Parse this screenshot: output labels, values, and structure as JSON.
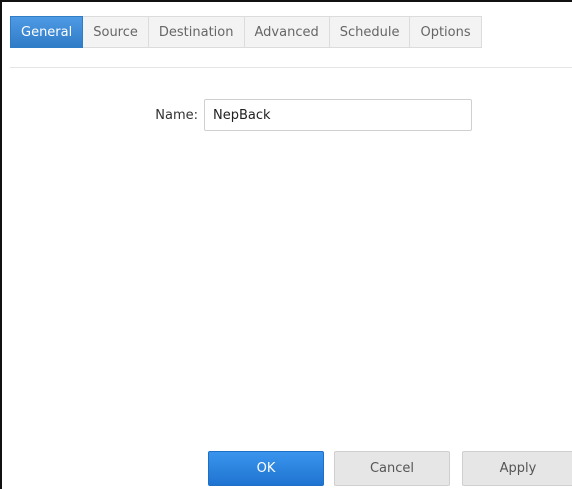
{
  "tabs": [
    {
      "label": "General",
      "active": true
    },
    {
      "label": "Source",
      "active": false
    },
    {
      "label": "Destination",
      "active": false
    },
    {
      "label": "Advanced",
      "active": false
    },
    {
      "label": "Schedule",
      "active": false
    },
    {
      "label": "Options",
      "active": false
    }
  ],
  "form": {
    "name_label": "Name:",
    "name_value": "NepBack"
  },
  "buttons": {
    "ok": "OK",
    "cancel": "Cancel",
    "apply": "Apply"
  },
  "colors": {
    "accent": "#3d8ad3",
    "primary_button": "#2d85e0"
  }
}
